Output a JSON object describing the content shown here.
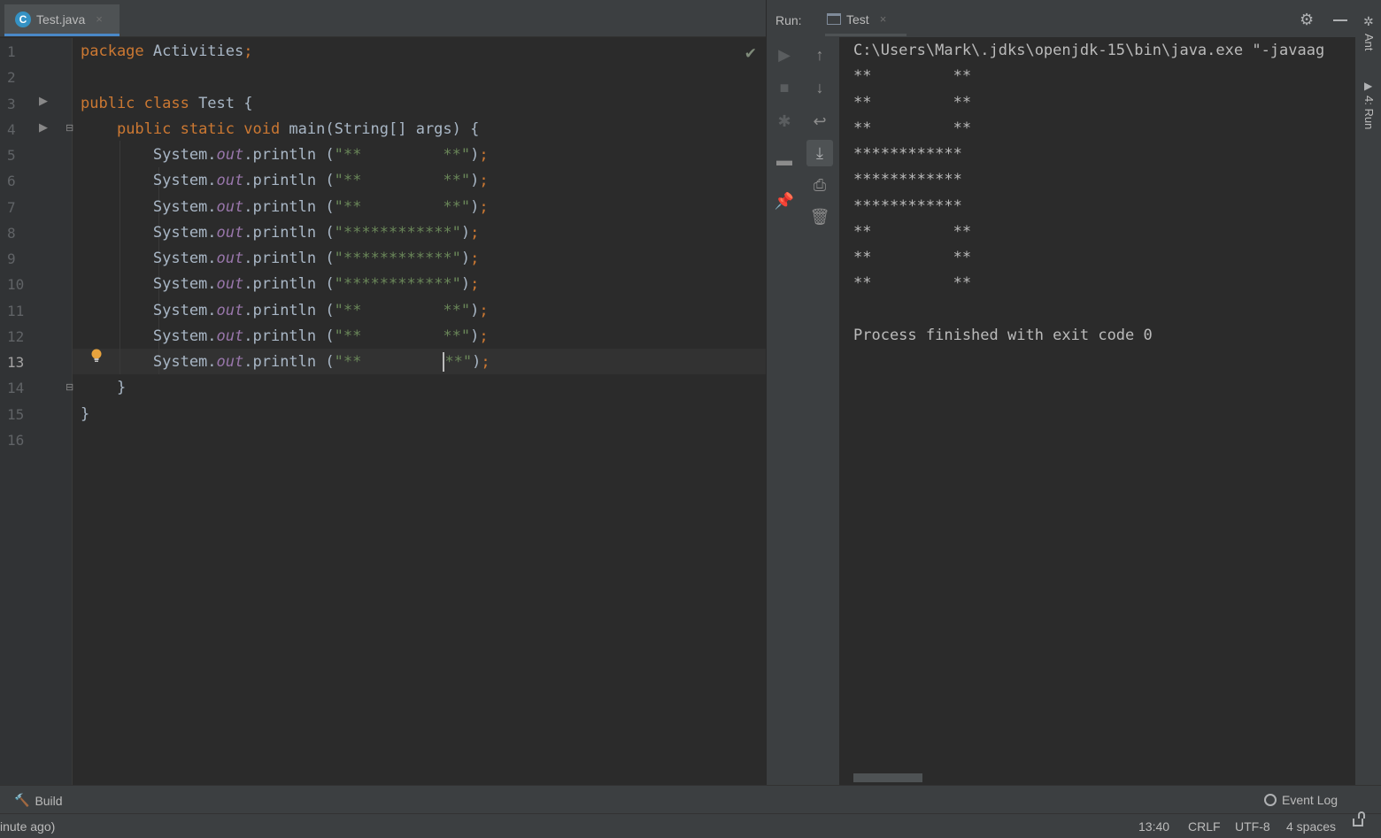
{
  "editor": {
    "tab": {
      "label": "Test.java",
      "close": "×"
    },
    "lines": [
      {
        "num": "1",
        "parts": [
          [
            "kw",
            "package"
          ],
          [
            "p",
            " Activities"
          ],
          [
            "kw",
            ";"
          ]
        ]
      },
      {
        "num": "2",
        "parts": []
      },
      {
        "num": "3",
        "parts": [
          [
            "kw",
            "public class"
          ],
          [
            "p",
            " Test {"
          ]
        ]
      },
      {
        "num": "4",
        "parts": [
          [
            "p",
            "    "
          ],
          [
            "kw",
            "public static void"
          ],
          [
            "p",
            " main(String[] args) {"
          ]
        ]
      },
      {
        "num": "5",
        "parts": [
          [
            "p",
            "        System."
          ],
          [
            "fld",
            "out"
          ],
          [
            "p",
            ".println ("
          ],
          [
            "str",
            "\"**         **\""
          ],
          [
            "p",
            ")"
          ],
          [
            "kw",
            ";"
          ]
        ]
      },
      {
        "num": "6",
        "parts": [
          [
            "p",
            "        System."
          ],
          [
            "fld",
            "out"
          ],
          [
            "p",
            ".println ("
          ],
          [
            "str",
            "\"**         **\""
          ],
          [
            "p",
            ")"
          ],
          [
            "kw",
            ";"
          ]
        ]
      },
      {
        "num": "7",
        "parts": [
          [
            "p",
            "        System."
          ],
          [
            "fld",
            "out"
          ],
          [
            "p",
            ".println ("
          ],
          [
            "str",
            "\"**         **\""
          ],
          [
            "p",
            ")"
          ],
          [
            "kw",
            ";"
          ]
        ]
      },
      {
        "num": "8",
        "parts": [
          [
            "p",
            "        System."
          ],
          [
            "fld",
            "out"
          ],
          [
            "p",
            ".println ("
          ],
          [
            "str",
            "\"************\""
          ],
          [
            "p",
            ")"
          ],
          [
            "kw",
            ";"
          ]
        ]
      },
      {
        "num": "9",
        "parts": [
          [
            "p",
            "        System."
          ],
          [
            "fld",
            "out"
          ],
          [
            "p",
            ".println ("
          ],
          [
            "str",
            "\"************\""
          ],
          [
            "p",
            ")"
          ],
          [
            "kw",
            ";"
          ]
        ]
      },
      {
        "num": "10",
        "parts": [
          [
            "p",
            "        System."
          ],
          [
            "fld",
            "out"
          ],
          [
            "p",
            ".println ("
          ],
          [
            "str",
            "\"************\""
          ],
          [
            "p",
            ")"
          ],
          [
            "kw",
            ";"
          ]
        ]
      },
      {
        "num": "11",
        "parts": [
          [
            "p",
            "        System."
          ],
          [
            "fld",
            "out"
          ],
          [
            "p",
            ".println ("
          ],
          [
            "str",
            "\"**         **\""
          ],
          [
            "p",
            ")"
          ],
          [
            "kw",
            ";"
          ]
        ]
      },
      {
        "num": "12",
        "parts": [
          [
            "p",
            "        System."
          ],
          [
            "fld",
            "out"
          ],
          [
            "p",
            ".println ("
          ],
          [
            "str",
            "\"**         **\""
          ],
          [
            "p",
            ")"
          ],
          [
            "kw",
            ";"
          ]
        ]
      },
      {
        "num": "13",
        "parts": [
          [
            "p",
            "        System."
          ],
          [
            "fld",
            "out"
          ],
          [
            "p",
            ".println ("
          ],
          [
            "str",
            "\"**         "
          ],
          [
            "caret",
            ""
          ],
          [
            "str",
            "**\""
          ],
          [
            "p",
            ")"
          ],
          [
            "kw",
            ";"
          ]
        ],
        "current": true
      },
      {
        "num": "14",
        "parts": [
          [
            "p",
            "    }"
          ]
        ]
      },
      {
        "num": "15",
        "parts": [
          [
            "p",
            "}"
          ]
        ]
      },
      {
        "num": "16",
        "parts": []
      }
    ]
  },
  "run": {
    "label": "Run:",
    "tab": {
      "label": "Test",
      "close": "×"
    },
    "output": [
      "C:\\Users\\Mark\\.jdks\\openjdk-15\\bin\\java.exe \"-javaag",
      "**         **",
      "**         **",
      "**         **",
      "************",
      "************",
      "************",
      "**         **",
      "**         **",
      "**         **",
      "",
      "Process finished with exit code 0"
    ]
  },
  "right_strip": {
    "ant": "Ant",
    "run": "4: Run"
  },
  "tool_window_bar": {
    "build": "Build",
    "event_log": "Event Log"
  },
  "status_bar": {
    "message": "inute ago)",
    "position": "13:40",
    "line_sep": "CRLF",
    "encoding": "UTF-8",
    "indent": "4 spaces"
  }
}
